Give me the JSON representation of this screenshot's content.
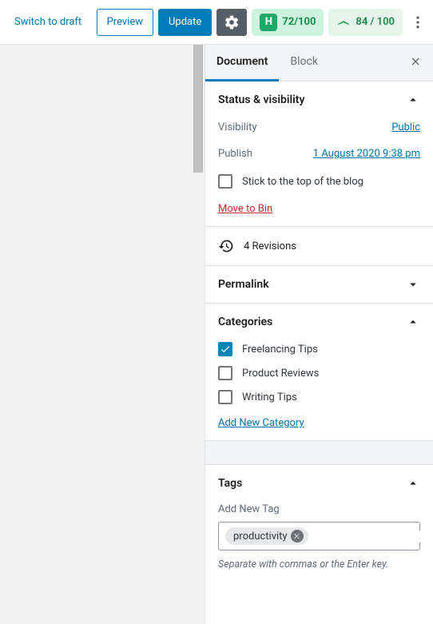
{
  "toolbar": {
    "switch_draft": "Switch to draft",
    "preview": "Preview",
    "update": "Update",
    "h_score": "72/100",
    "y_score": "84 / 100"
  },
  "tabs": {
    "document": "Document",
    "block": "Block"
  },
  "status": {
    "head": "Status & visibility",
    "visibility_label": "Visibility",
    "visibility_value": "Public",
    "publish_label": "Publish",
    "publish_value": "1 August 2020 9:38 pm",
    "stick_label": "Stick to the top of the blog",
    "move_bin": "Move to Bin"
  },
  "revisions": {
    "label": "4 Revisions"
  },
  "permalink": {
    "head": "Permalink"
  },
  "categories": {
    "head": "Categories",
    "items": [
      {
        "label": "Freelancing Tips",
        "checked": true
      },
      {
        "label": "Product Reviews",
        "checked": false
      },
      {
        "label": "Writing Tips",
        "checked": false
      }
    ],
    "add": "Add New Category"
  },
  "tags": {
    "head": "Tags",
    "sub": "Add New Tag",
    "tokens": [
      "productivity"
    ],
    "hint": "Separate with commas or the Enter key."
  }
}
